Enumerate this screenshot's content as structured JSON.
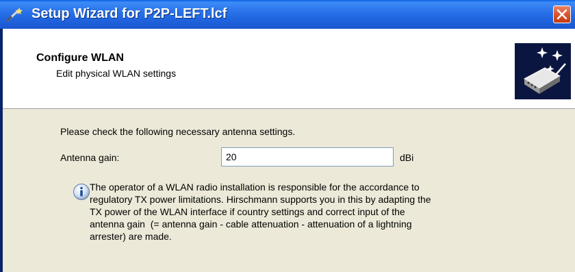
{
  "window": {
    "title": "Setup Wizard for P2P-LEFT.lcf",
    "icons": {
      "wand": "wand-icon",
      "close": "close-icon"
    },
    "colors": {
      "titlebar": "#2A73EA",
      "close_button": "#D9552E",
      "window_bg": "#ECE9D8"
    }
  },
  "header": {
    "title": "Configure WLAN",
    "subtitle": "Edit physical WLAN settings",
    "logo_icon": "wizard-router-icon"
  },
  "body": {
    "intro": "Please check the following necessary antenna settings.",
    "antenna_gain": {
      "label": "Antenna gain:",
      "value": "20",
      "unit": "dBi"
    },
    "info": {
      "icon": "info-icon",
      "lines": [
        "The operator of a WLAN radio installation is responsible for the accordance to",
        "regulatory TX power limitations. Hirschmann supports you in this by adapting the",
        "TX power of the WLAN interface if country settings and correct input of the",
        "antenna gain  (= antenna gain - cable attenuation - attenuation of a lightning",
        "arrester) are made."
      ]
    }
  }
}
